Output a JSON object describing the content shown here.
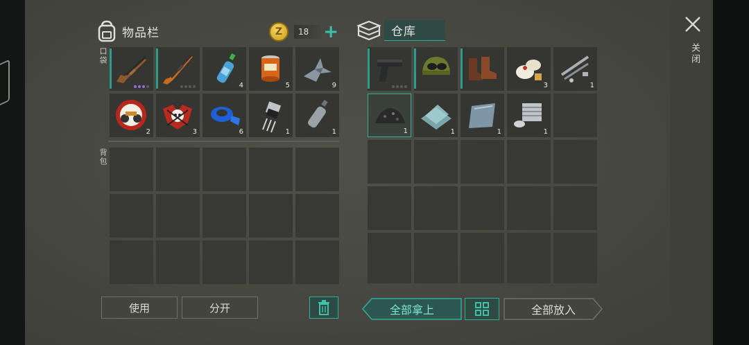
{
  "inventory": {
    "title": "物品栏",
    "pocket_label": "口袋",
    "backpack_label": "背包"
  },
  "currency": {
    "amount": "18",
    "coin_letter": "Z"
  },
  "storage": {
    "title": "仓库"
  },
  "pocket_items": [
    {
      "name": "shotgun",
      "qty": "",
      "quality_dots": "purple-3"
    },
    {
      "name": "hunting-rifle",
      "qty": "",
      "quality_dots": "grey-4"
    },
    {
      "name": "water-bottle",
      "qty": "4"
    },
    {
      "name": "canned-food",
      "qty": "5"
    },
    {
      "name": "metal-scrap",
      "qty": "9"
    },
    {
      "name": "live-fast-patch",
      "qty": "2"
    },
    {
      "name": "skull-patch",
      "qty": "3"
    },
    {
      "name": "duct-tape",
      "qty": "6"
    },
    {
      "name": "transistor",
      "qty": "1"
    },
    {
      "name": "empty-plastic-bottle",
      "qty": "1"
    }
  ],
  "storage_items": [
    {
      "name": "pistol",
      "qty": "",
      "quality_dots": "grey-4"
    },
    {
      "name": "helmet-with-goggles",
      "qty": ""
    },
    {
      "name": "leather-boots",
      "qty": ""
    },
    {
      "name": "bandage-kit",
      "qty": "3"
    },
    {
      "name": "metal-pipes",
      "qty": "1"
    },
    {
      "name": "gunpowder-pile",
      "qty": "1"
    },
    {
      "name": "glass-sheets",
      "qty": "1"
    },
    {
      "name": "metal-plate",
      "qty": "1"
    },
    {
      "name": "engine-part",
      "qty": "1"
    }
  ],
  "buttons": {
    "use": "使用",
    "split": "分开",
    "take_all": "全部拿上",
    "put_all": "全部放入",
    "close": "关闭"
  },
  "colors": {
    "accent": "#2fae98",
    "slot_bg": "#353631",
    "panel_bg": "#4a4b45"
  }
}
